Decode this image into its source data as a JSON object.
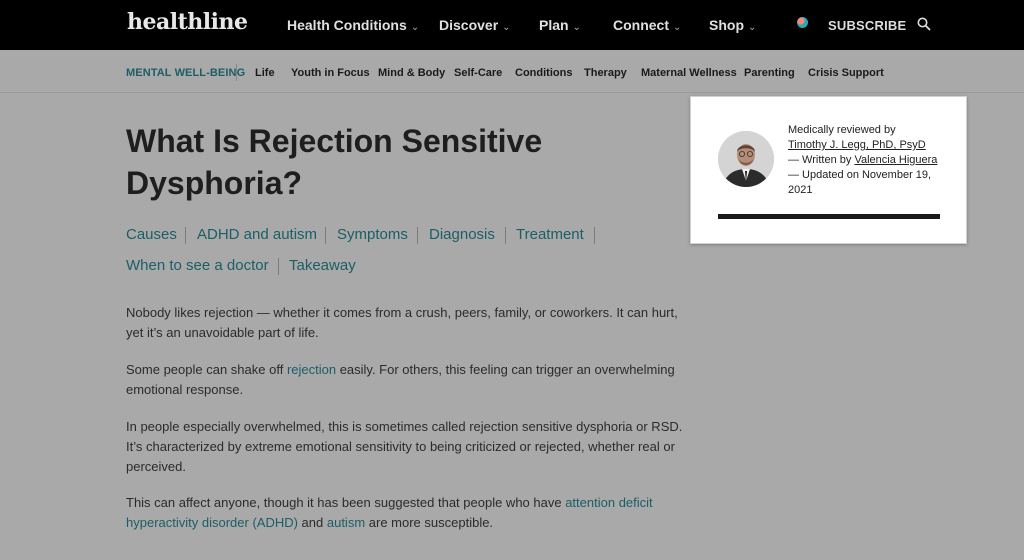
{
  "header": {
    "logo": "healthline",
    "nav": [
      {
        "label": "Health Conditions",
        "chevron": "⌄"
      },
      {
        "label": "Discover",
        "chevron": "⌄"
      },
      {
        "label": "Plan",
        "chevron": "⌄"
      },
      {
        "label": "Connect",
        "chevron": "⌄"
      },
      {
        "label": "Shop",
        "chevron": "⌄"
      }
    ],
    "subscribe": "SUBSCRIBE",
    "icons": {
      "globe": "globe-icon",
      "search": "search-icon"
    }
  },
  "subnav": {
    "brand": "MENTAL WELL-BEING",
    "items": [
      "Life",
      "Youth in Focus",
      "Mind & Body",
      "Self-Care",
      "Conditions",
      "Therapy",
      "Maternal Wellness",
      "Parenting",
      "Crisis Support"
    ]
  },
  "article": {
    "title": "What Is Rejection Sensitive Dysphoria?",
    "toc": [
      "Causes",
      "ADHD and autism",
      "Symptoms",
      "Diagnosis",
      "Treatment",
      "When to see a doctor",
      "Takeaway"
    ],
    "paragraphs": {
      "p1": "Nobody likes rejection — whether it comes from a crush, peers, family, or coworkers. It can hurt, yet it’s an unavoidable part of life.",
      "p2_before": "Some people can shake off ",
      "p2_link": "rejection",
      "p2_after": " easily. For others, this feeling can trigger an overwhelming emotional response.",
      "p3": "In people especially overwhelmed, this is sometimes called rejection sensitive dysphoria or RSD. It’s characterized by extreme emotional sensitivity to being criticized or rejected, whether real or perceived.",
      "p4_before": "This can affect anyone, though it has been suggested that people who have ",
      "p4_link1": "attention deficit hyperactivity disorder (ADHD)",
      "p4_mid": " and ",
      "p4_link2": "autism",
      "p4_after": " are more susceptible."
    }
  },
  "reviewer": {
    "reviewed_by": "Medically reviewed by",
    "reviewer_name": "Timothy J. Legg, PhD, PsyD",
    "written_by": "— Written by",
    "author_name": "Valencia Higuera",
    "updated": "— Updated on November 19, 2021"
  },
  "colors": {
    "link": "#1b5e66",
    "topbar": "#000000",
    "overlay": "#a9a9a9"
  }
}
